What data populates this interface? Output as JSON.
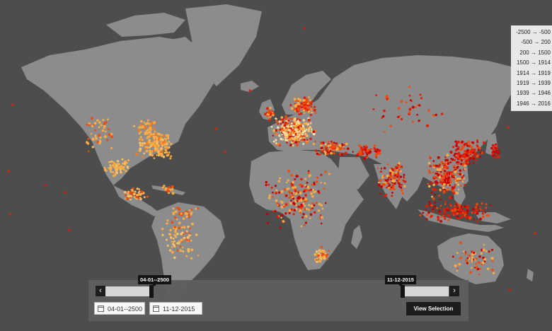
{
  "legend": {
    "items": [
      {
        "label": "-2500 → -500",
        "color": "#f7e7b5"
      },
      {
        "label": "-500 → 200",
        "color": "#f7d795"
      },
      {
        "label": "200 → 1500",
        "color": "#f9c06a"
      },
      {
        "label": "1500 → 1914",
        "color": "#fbab44"
      },
      {
        "label": "1914 → 1919",
        "color": "#f57a1e"
      },
      {
        "label": "1919 → 1939",
        "color": "#ef4a0d"
      },
      {
        "label": "1939 → 1946",
        "color": "#e01d05"
      },
      {
        "label": "1946 → 2016",
        "color": "#c40000"
      }
    ]
  },
  "timeline": {
    "start_tooltip": "04-01--2500",
    "end_tooltip": "11-12-2015",
    "start_field": "04-01--2500",
    "end_field": "11-12-2015",
    "prev_glyph": "‹",
    "next_glyph": "›",
    "view_button": "View Selection"
  },
  "colors": {
    "background": "#4d4d4d",
    "land": "#8c8c8c",
    "panel": "#5e5e5e",
    "dark": "#1c1c1c"
  },
  "icons": [
    "calendar-icon",
    "chevron-left-icon",
    "chevron-right-icon"
  ]
}
